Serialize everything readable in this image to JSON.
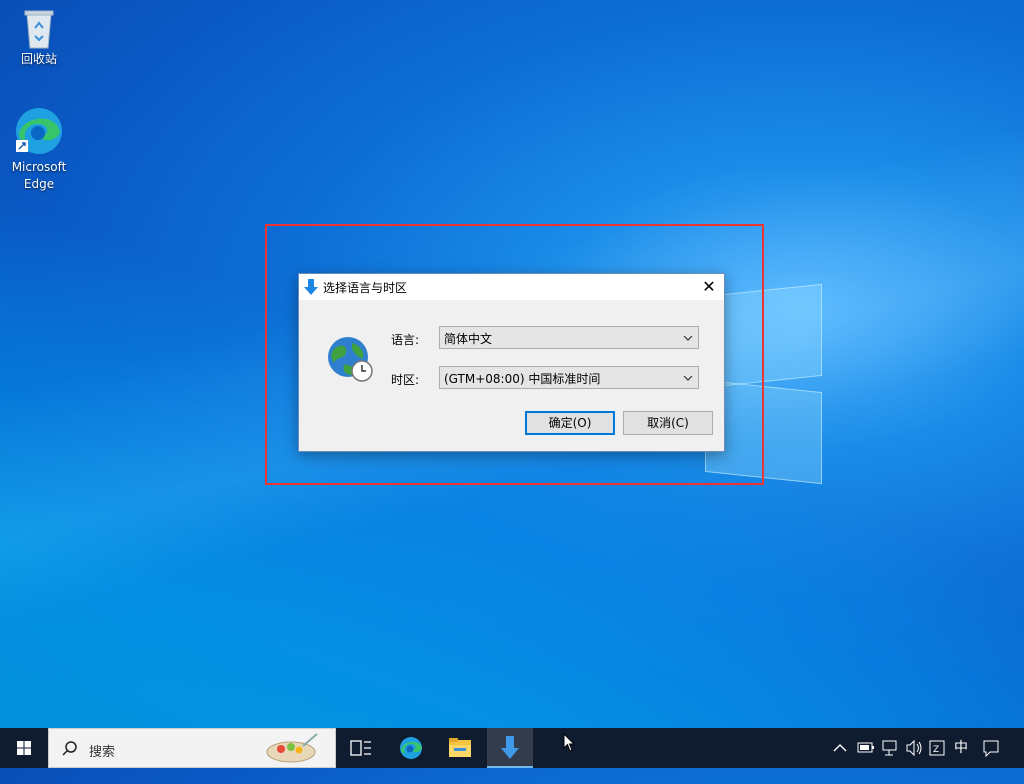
{
  "desktop": {
    "icons": [
      {
        "label": "回收站",
        "icon": "recycle-bin-icon"
      },
      {
        "label": "Microsoft Edge",
        "icon": "edge-icon"
      }
    ]
  },
  "dialog": {
    "title": "选择语言与时区",
    "title_icon": "download-arrow-icon",
    "close_glyph": "✕",
    "language_label": "语言:",
    "language_value": "简体中文",
    "timezone_label": "时区:",
    "timezone_value": "(GTM+08:00) 中国标准时间",
    "ok_label": "确定(O)",
    "cancel_label": "取消(C)"
  },
  "taskbar": {
    "search_placeholder": "搜索",
    "apps": [
      "task-view-icon",
      "edge-icon",
      "file-explorer-icon",
      "download-arrow-icon"
    ],
    "tray": {
      "ime": "中",
      "icons": [
        "chevron-up-icon",
        "battery-icon",
        "network-icon",
        "volume-icon",
        "ime-mode-icon",
        "notification-icon"
      ]
    }
  },
  "colors": {
    "highlight": "#e33333",
    "accent": "#0078d7"
  }
}
